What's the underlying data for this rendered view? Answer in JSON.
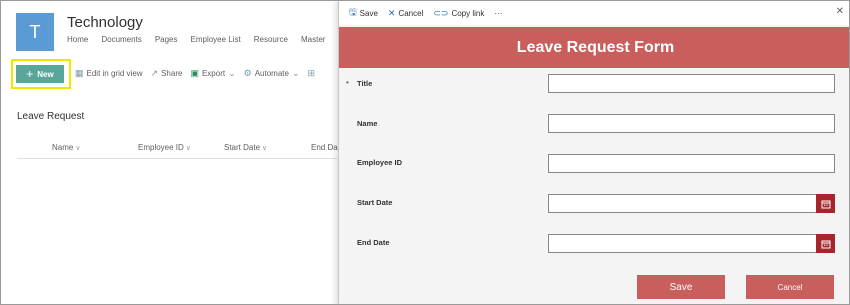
{
  "site": {
    "tile_letter": "T",
    "title": "Technology",
    "nav": [
      "Home",
      "Documents",
      "Pages",
      "Employee List",
      "Resource",
      "Master"
    ]
  },
  "commandbar": {
    "new_label": "New",
    "items": [
      "Edit in grid view",
      "Share",
      "Export",
      "Automate"
    ]
  },
  "list": {
    "title": "Leave Request",
    "columns": [
      "Name",
      "Employee ID",
      "Start Date",
      "End Da"
    ]
  },
  "panel": {
    "toolbar": {
      "save": "Save",
      "cancel": "Cancel",
      "copy_link": "Copy link",
      "more": "···",
      "close": "✕"
    },
    "form_title": "Leave Request Form",
    "fields": [
      {
        "label": "Title",
        "required_marker": "•",
        "value": ""
      },
      {
        "label": "Name",
        "value": ""
      },
      {
        "label": "Employee ID",
        "value": ""
      },
      {
        "label": "Start Date",
        "value": ""
      },
      {
        "label": "End Date",
        "value": ""
      }
    ],
    "save_button": "Save",
    "cancel_button": "Cancel"
  },
  "colors": {
    "brand_red": "#c85f5d",
    "calendar_red": "#a4262c",
    "new_button": "#5aa69b",
    "site_tile": "#5b9bd5",
    "highlight": "#f2e600"
  }
}
